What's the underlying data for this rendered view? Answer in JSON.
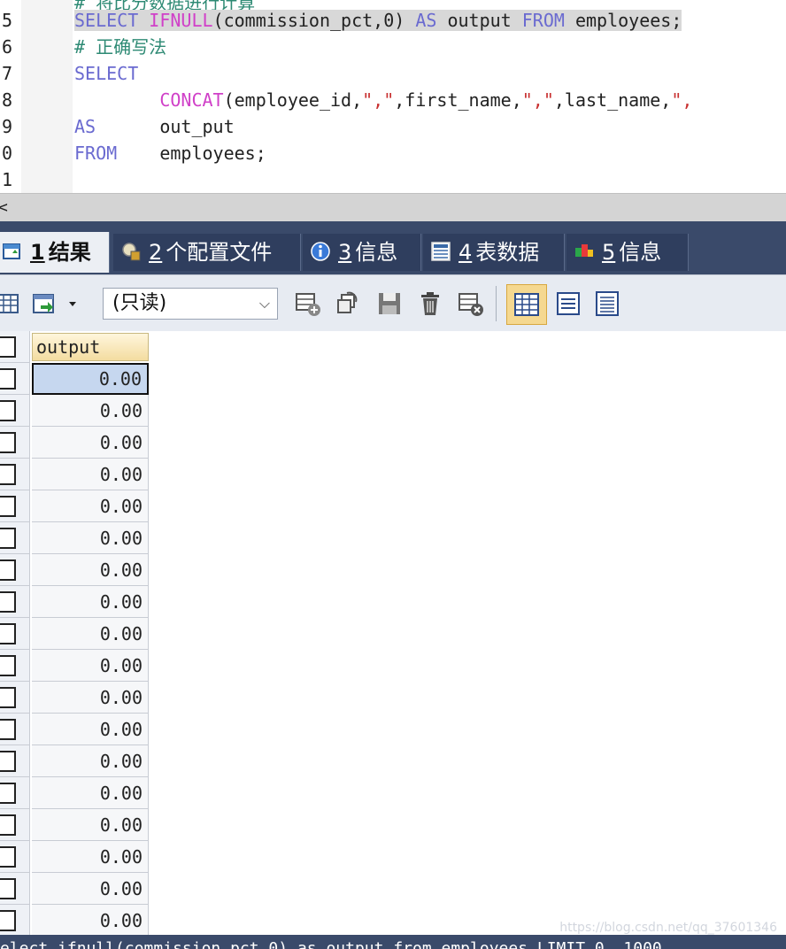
{
  "editor": {
    "cut_comment": "# 将比分数据进行计算",
    "lines": [
      {
        "num": "5",
        "tokens": [
          {
            "t": "SELECT ",
            "c": "kw"
          },
          {
            "t": "IFNULL",
            "c": "fn"
          },
          {
            "t": "(commission_pct,0) ",
            "c": "pl"
          },
          {
            "t": "AS",
            "c": "kw"
          },
          {
            "t": " output ",
            "c": "pl"
          },
          {
            "t": "FROM",
            "c": "kw"
          },
          {
            "t": " employees;",
            "c": "pl"
          }
        ]
      },
      {
        "num": "6",
        "tokens": [
          {
            "t": "# 正确写法",
            "c": "cm"
          }
        ]
      },
      {
        "num": "7",
        "tokens": [
          {
            "t": "SELECT",
            "c": "kw"
          }
        ]
      },
      {
        "num": "8",
        "tokens": [
          {
            "t": "        ",
            "c": "pl"
          },
          {
            "t": "CONCAT",
            "c": "fn"
          },
          {
            "t": "(employee_id,",
            "c": "pl"
          },
          {
            "t": "\",\"",
            "c": "str"
          },
          {
            "t": ",first_name,",
            "c": "pl"
          },
          {
            "t": "\",\"",
            "c": "str"
          },
          {
            "t": ",last_name,",
            "c": "pl"
          },
          {
            "t": "\",",
            "c": "str"
          }
        ]
      },
      {
        "num": "9",
        "tokens": [
          {
            "t": "AS",
            "c": "kw"
          },
          {
            "t": "      out_put",
            "c": "pl"
          }
        ]
      },
      {
        "num": "0",
        "tokens": [
          {
            "t": "FROM",
            "c": "kw"
          },
          {
            "t": "    employees;",
            "c": "pl"
          }
        ]
      },
      {
        "num": "1",
        "tokens": []
      }
    ]
  },
  "splitter": {
    "mark": "<"
  },
  "tabs": [
    {
      "num": "1",
      "label": "结果",
      "icon": "result-grid-icon"
    },
    {
      "num": "2",
      "label": "个配置文件",
      "icon": "profile-icon"
    },
    {
      "num": "3",
      "label": "信息",
      "icon": "info-icon"
    },
    {
      "num": "4",
      "label": "表数据",
      "icon": "table-data-icon"
    },
    {
      "num": "5",
      "label": "信息",
      "icon": "info-color-icon"
    }
  ],
  "toolbar": {
    "mode_select": "(只读)"
  },
  "grid": {
    "column": "output",
    "rows": [
      "0.00",
      "0.00",
      "0.00",
      "0.00",
      "0.00",
      "0.00",
      "0.00",
      "0.00",
      "0.00",
      "0.00",
      "0.00",
      "0.00",
      "0.00",
      "0.00",
      "0.00",
      "0.00",
      "0.00",
      "0.00"
    ]
  },
  "status": {
    "text": "elect ifnull(commission_pct,0) as output from employees LIMIT 0, 1000"
  },
  "watermark": "https://blog.csdn.net/qq_37601346",
  "colors": {
    "keyword": "#6a6ad0",
    "function": "#d040c8",
    "string": "#c83030",
    "comment": "#2e8a74",
    "chrome": "#3a4a6a"
  }
}
